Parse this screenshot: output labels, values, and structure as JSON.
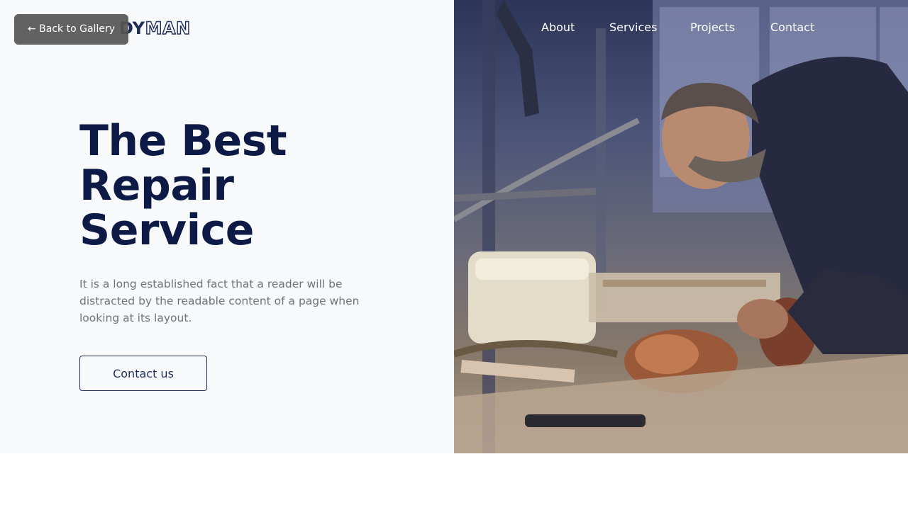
{
  "brand": {
    "logo_solid": "DY",
    "logo_outline": "MAN"
  },
  "back_button": {
    "label": "← Back to Gallery"
  },
  "nav": {
    "items": [
      {
        "label": "About"
      },
      {
        "label": "Services"
      },
      {
        "label": "Projects"
      },
      {
        "label": "Contact"
      }
    ]
  },
  "hero": {
    "headline_lines": [
      "The Best",
      "Repair",
      "Service"
    ],
    "description": "It is a long established fact that a reader will be distracted by the readable content of a page when looking at its layout.",
    "cta_label": "Contact us",
    "image_subject": "mechanic-at-workbench-photo"
  },
  "colors": {
    "headline": "#0c1a45",
    "brand_navy": "#1f2d5a",
    "left_background": "#f8f9fb",
    "body_text": "#707378",
    "back_button_bg": "#555555"
  }
}
